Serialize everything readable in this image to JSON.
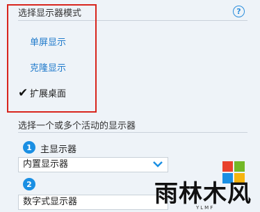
{
  "mode_section": {
    "title": "选择显示器模式",
    "help_icon": "help-circle-icon",
    "options": [
      "单屏显示",
      "克隆显示",
      "扩展桌面"
    ],
    "selected_index": 2
  },
  "active_section": {
    "title": "选择一个或多个活动的显示器",
    "display1": {
      "number": "1",
      "label": "主显示器",
      "selected": "内置显示器"
    },
    "display2": {
      "number": "2",
      "selected": "数字式显示器"
    }
  },
  "watermark": {
    "text": "雨林木风",
    "sub": "YLMF"
  },
  "colors": {
    "accent": "#1a8fe3",
    "link": "#1f7acb",
    "highlight_box": "#d8241c"
  }
}
